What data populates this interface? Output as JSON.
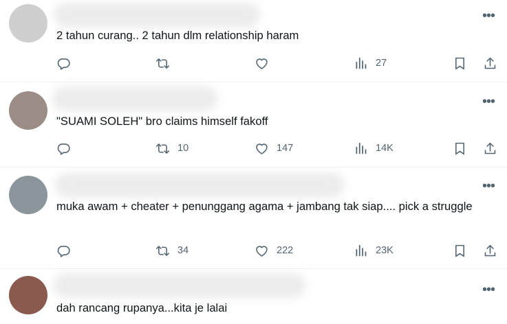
{
  "replies": [
    {
      "text": "2 tahun curang.. 2 tahun dlm relationship haram",
      "replies_count": "",
      "retweets": "",
      "likes": "",
      "views": "27",
      "avatar_color": "#cfcfcf"
    },
    {
      "text": "\"SUAMI SOLEH\" bro claims himself fakoff",
      "replies_count": "",
      "retweets": "10",
      "likes": "147",
      "views": "14K",
      "avatar_color": "#9c8c86"
    },
    {
      "text": "muka awam + cheater + penunggang agama + jambang tak siap.... pick a struggle",
      "replies_count": "",
      "retweets": "34",
      "likes": "222",
      "views": "23K",
      "avatar_color": "#8a969b"
    },
    {
      "text": "dah rancang rupanya...kita je lalai",
      "avatar_color": "#8a5a4e"
    }
  ],
  "icons": {
    "reply": "reply-icon",
    "retweet": "retweet-icon",
    "like": "heart-icon",
    "views": "views-icon",
    "bookmark": "bookmark-icon",
    "share": "share-icon",
    "more": "more-icon"
  },
  "colors": {
    "text": "#0f1419",
    "secondary": "#536471",
    "divider": "#eff3f4"
  }
}
